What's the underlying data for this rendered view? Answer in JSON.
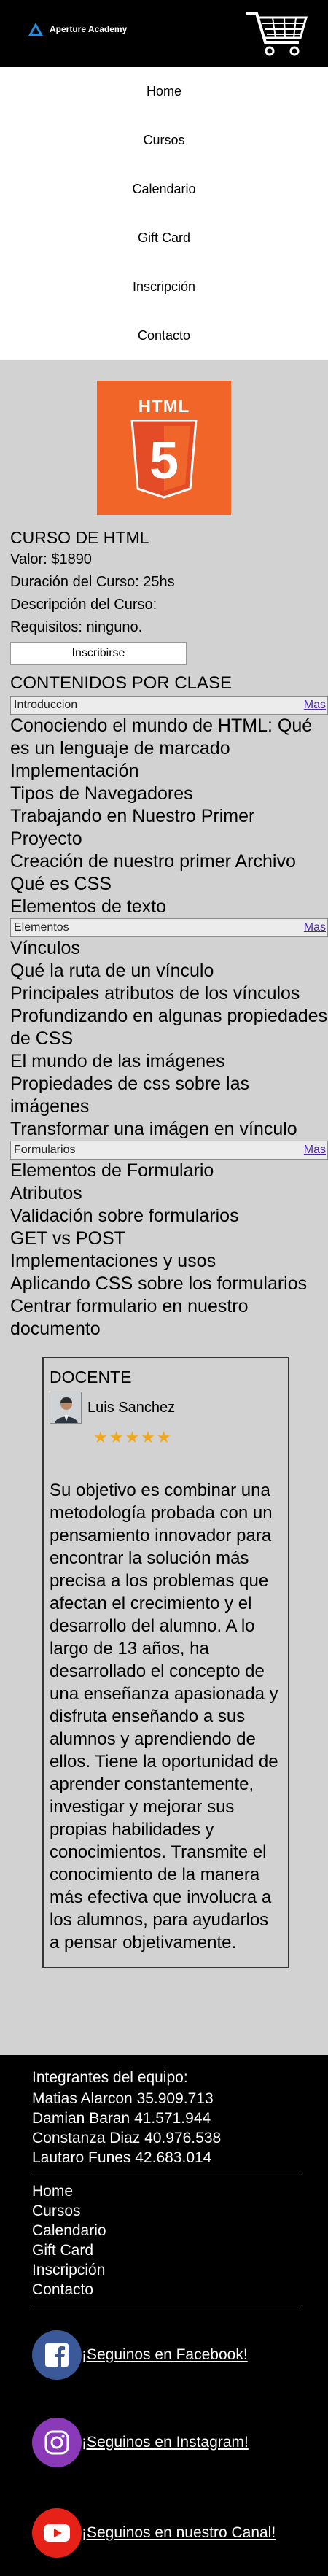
{
  "header": {
    "brand": "Aperture Academy",
    "cart_icon": "shopping-cart-icon"
  },
  "nav": {
    "items": [
      "Home",
      "Cursos",
      "Calendario",
      "Gift Card",
      "Inscripción",
      "Contacto"
    ]
  },
  "course": {
    "image_text": "HTML",
    "image_number": "5",
    "title": "CURSO DE HTML",
    "price": "Valor: $1890",
    "duration": "Duración del Curso: 25hs",
    "description": "Descripción del Curso:",
    "requirements": "Requisitos: ninguno.",
    "enroll_label": "Inscribirse",
    "contents_title": "CONTENIDOS POR CLASE"
  },
  "modules": [
    {
      "name": "Introduccion",
      "more": "Mas",
      "topics": [
        "Conociendo el mundo de HTML: Qué es un lenguaje de marcado",
        "Implementación",
        "Tipos de Navegadores",
        "Trabajando en Nuestro Primer Proyecto",
        "Creación de nuestro primer Archivo",
        "Qué es CSS",
        "Elementos de texto"
      ]
    },
    {
      "name": "Elementos",
      "more": "Mas",
      "topics": [
        "Vínculos",
        "Qué la ruta de un vínculo",
        "Principales atributos de los vínculos",
        "Profundizando en algunas propiedades de CSS",
        "El mundo de las imágenes",
        "Propiedades de css sobre las imágenes",
        "Transformar una imágen en vínculo"
      ]
    },
    {
      "name": "Formularios",
      "more": "Mas",
      "topics": [
        "Elementos de Formulario",
        "Atributos",
        "Validación sobre formularios",
        "GET vs POST",
        "Implementaciones y usos",
        "Aplicando CSS sobre los formularios",
        "Centrar formulario en nuestro documento"
      ]
    }
  ],
  "teacher": {
    "title": "DOCENTE",
    "name": "Luis Sanchez",
    "rating": 5,
    "stars": "★★★★★",
    "bio": "Su objetivo es combinar una metodología probada con un pensamiento innovador para encontrar la solución más precisa a los problemas que afectan el crecimiento y el desarrollo del alumno. A lo largo de 13 años, ha desarrollado el concepto de una enseñanza apasionada y disfruta enseñando a sus alumnos y aprendiendo de ellos. Tiene la oportunidad de aprender constantemente, investigar y mejorar sus propias habilidades y conocimientos. Transmite el conocimiento de la manera más efectiva que involucra a los alumnos, para ayudarlos a pensar objetivamente."
  },
  "footer": {
    "team_title": "Integrantes del equipo:",
    "members": [
      "Matias Alarcon 35.909.713",
      "Damian Baran 41.571.944",
      "Constanza Diaz 40.976.538",
      "Lautaro Funes 42.683.014"
    ],
    "nav": [
      "Home",
      "Cursos",
      "Calendario",
      "Gift Card",
      "Inscripción",
      "Contacto"
    ],
    "social": [
      {
        "icon": "facebook-icon",
        "label": "¡Seguinos en Facebook!",
        "color": "#3b5998"
      },
      {
        "icon": "instagram-icon",
        "label": "¡Seguinos en Instagram!",
        "color": "#8a3ab9"
      },
      {
        "icon": "youtube-icon",
        "label": "¡Seguinos en nuestro Canal!",
        "color": "#e62117"
      }
    ]
  },
  "colors": {
    "page_bg": "#d2d2d2",
    "header_bg": "#000000",
    "html5_orange": "#f16529",
    "star": "#f0a81a",
    "link": "#4a2a9a"
  }
}
